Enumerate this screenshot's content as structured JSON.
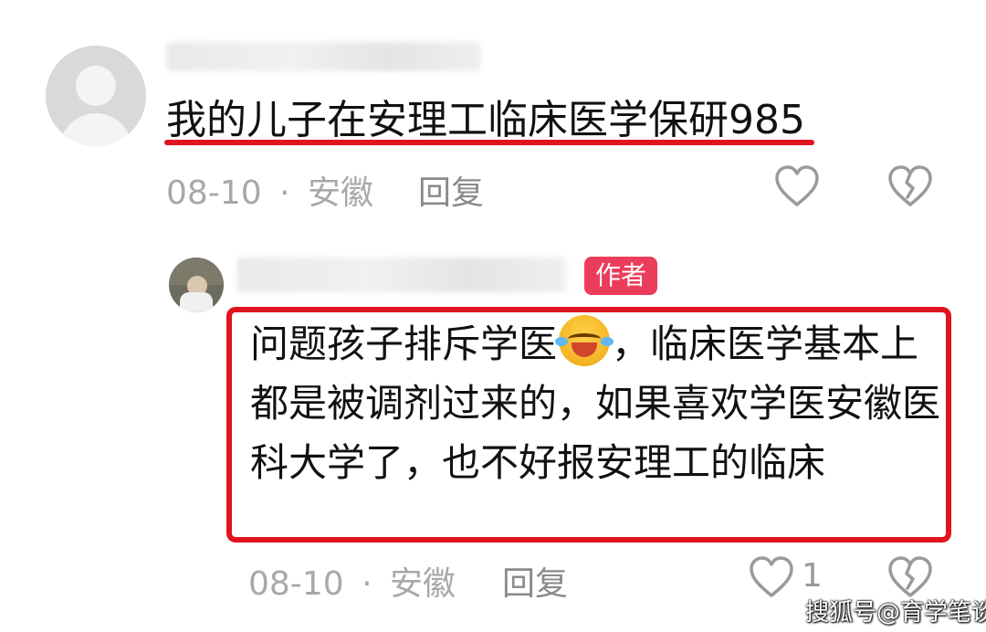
{
  "comment": {
    "text": "我的儿子在安理工临床医学保研985",
    "date": "08-10",
    "separator": "·",
    "location": "安徽",
    "reply_label": "回复"
  },
  "reply": {
    "badge": "作者",
    "text_part1": "问题孩子排斥学医",
    "text_part2": "，临床医学基本上都是被调剂过来的，如果喜欢学医安徽医科大学了，也不好报安理工的临床",
    "date": "08-10",
    "separator": "·",
    "location": "安徽",
    "reply_label": "回复",
    "like_count": "1"
  },
  "watermark": "搜狐号@育学笔谈",
  "colors": {
    "highlight_red": "#e0141e",
    "badge_pink": "#ec3c5b",
    "meta_gray": "#a8a8a8"
  },
  "icons": [
    "heart-icon",
    "broken-heart-icon",
    "laughing-crying-emoji-icon"
  ]
}
